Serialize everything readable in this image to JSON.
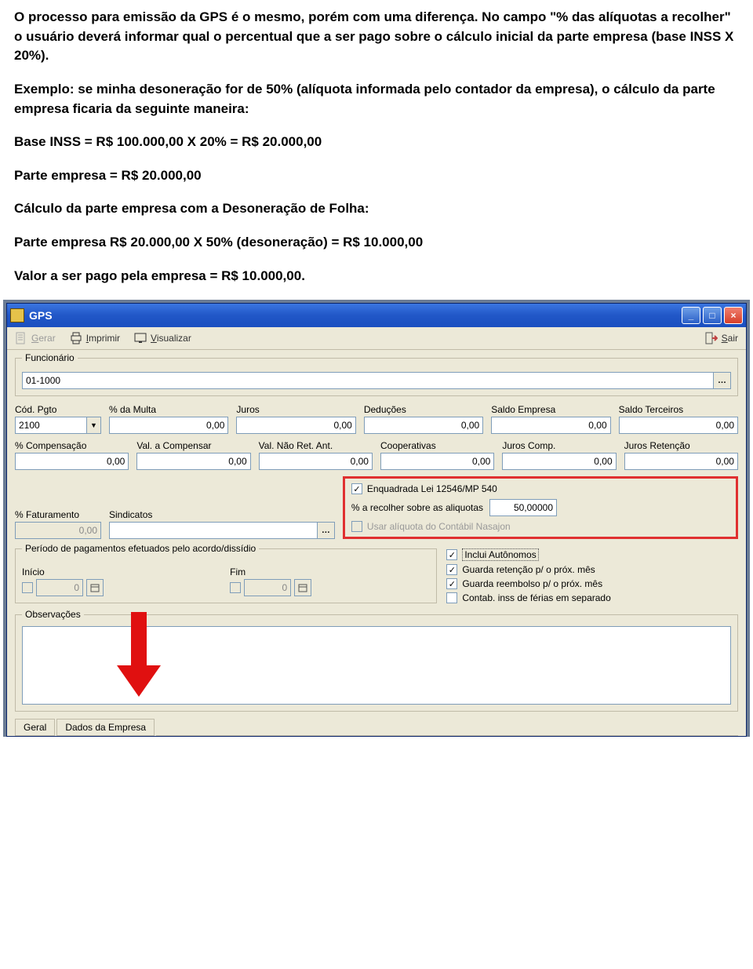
{
  "doc": {
    "p1_a": "O processo para emissão da GPS é o mesmo, porém com uma diferença. No campo ",
    "p1_b": "\"% das alíquotas a recolher\"",
    "p1_c": " o usuário deverá informar qual o percentual que a ser pago sobre o cálculo inicial da parte empresa (base INSS X 20%).",
    "p2": "Exemplo: se minha desoneração for de 50% (alíquota informada pelo contador da empresa), o cálculo da parte empresa ficaria da seguinte maneira:",
    "p3": "Base INSS = R$ 100.000,00 X 20% = R$ 20.000,00",
    "p4": "Parte empresa = R$ 20.000,00",
    "p5": "Cálculo da parte empresa com a Desoneração de Folha:",
    "p6": "Parte empresa R$ 20.000,00 X 50% (desoneração) = R$ 10.000,00",
    "p7": "Valor a ser pago pela empresa = R$ 10.000,00."
  },
  "win": {
    "title": "GPS",
    "toolbar": {
      "gerar": "Gerar",
      "imprimir": "Imprimir",
      "visualizar": "Visualizar",
      "sair": "Sair"
    },
    "group_funcionario": "Funcionário",
    "funcionario_value": "01-1000",
    "row1": {
      "cod_pgto_label": "Cód. Pgto",
      "cod_pgto_value": "2100",
      "multa_label": "% da Multa",
      "multa_value": "0,00",
      "juros_label": "Juros",
      "juros_value": "0,00",
      "deducoes_label": "Deduções",
      "deducoes_value": "0,00",
      "saldo_emp_label": "Saldo Empresa",
      "saldo_emp_value": "0,00",
      "saldo_ter_label": "Saldo Terceiros",
      "saldo_ter_value": "0,00"
    },
    "row2": {
      "compensacao_label": "% Compensação",
      "compensacao_value": "0,00",
      "val_comp_label": "Val. a Compensar",
      "val_comp_value": "0,00",
      "val_nao_ret_label": "Val. Não Ret. Ant.",
      "val_nao_ret_value": "0,00",
      "cooperativas_label": "Cooperativas",
      "cooperativas_value": "0,00",
      "juros_comp_label": "Juros Comp.",
      "juros_comp_value": "0,00",
      "juros_ret_label": "Juros Retenção",
      "juros_ret_value": "0,00"
    },
    "row3": {
      "faturamento_label": "% Faturamento",
      "faturamento_value": "0,00",
      "sindicatos_label": "Sindicatos",
      "enquadrada": "Enquadrada Lei 12546/MP 540",
      "recolher_label": "% a recolher sobre as aliquotas",
      "recolher_value": "50,00000",
      "usar_contabil": "Usar alíquota do Contábil Nasajon"
    },
    "periodo": {
      "group": "Período de pagamentos efetuados pelo acordo/dissídio",
      "inicio": "Início",
      "inicio_value": "0",
      "fim": "Fim",
      "fim_value": "0",
      "chk1": "Inclui Autônomos",
      "chk2": "Guarda retenção p/ o próx. mês",
      "chk3": "Guarda reembolso p/ o próx. mês",
      "chk4": "Contab. inss de férias em separado"
    },
    "obs_group": "Observações",
    "tabs": {
      "geral": "Geral",
      "dados": "Dados da Empresa"
    }
  }
}
